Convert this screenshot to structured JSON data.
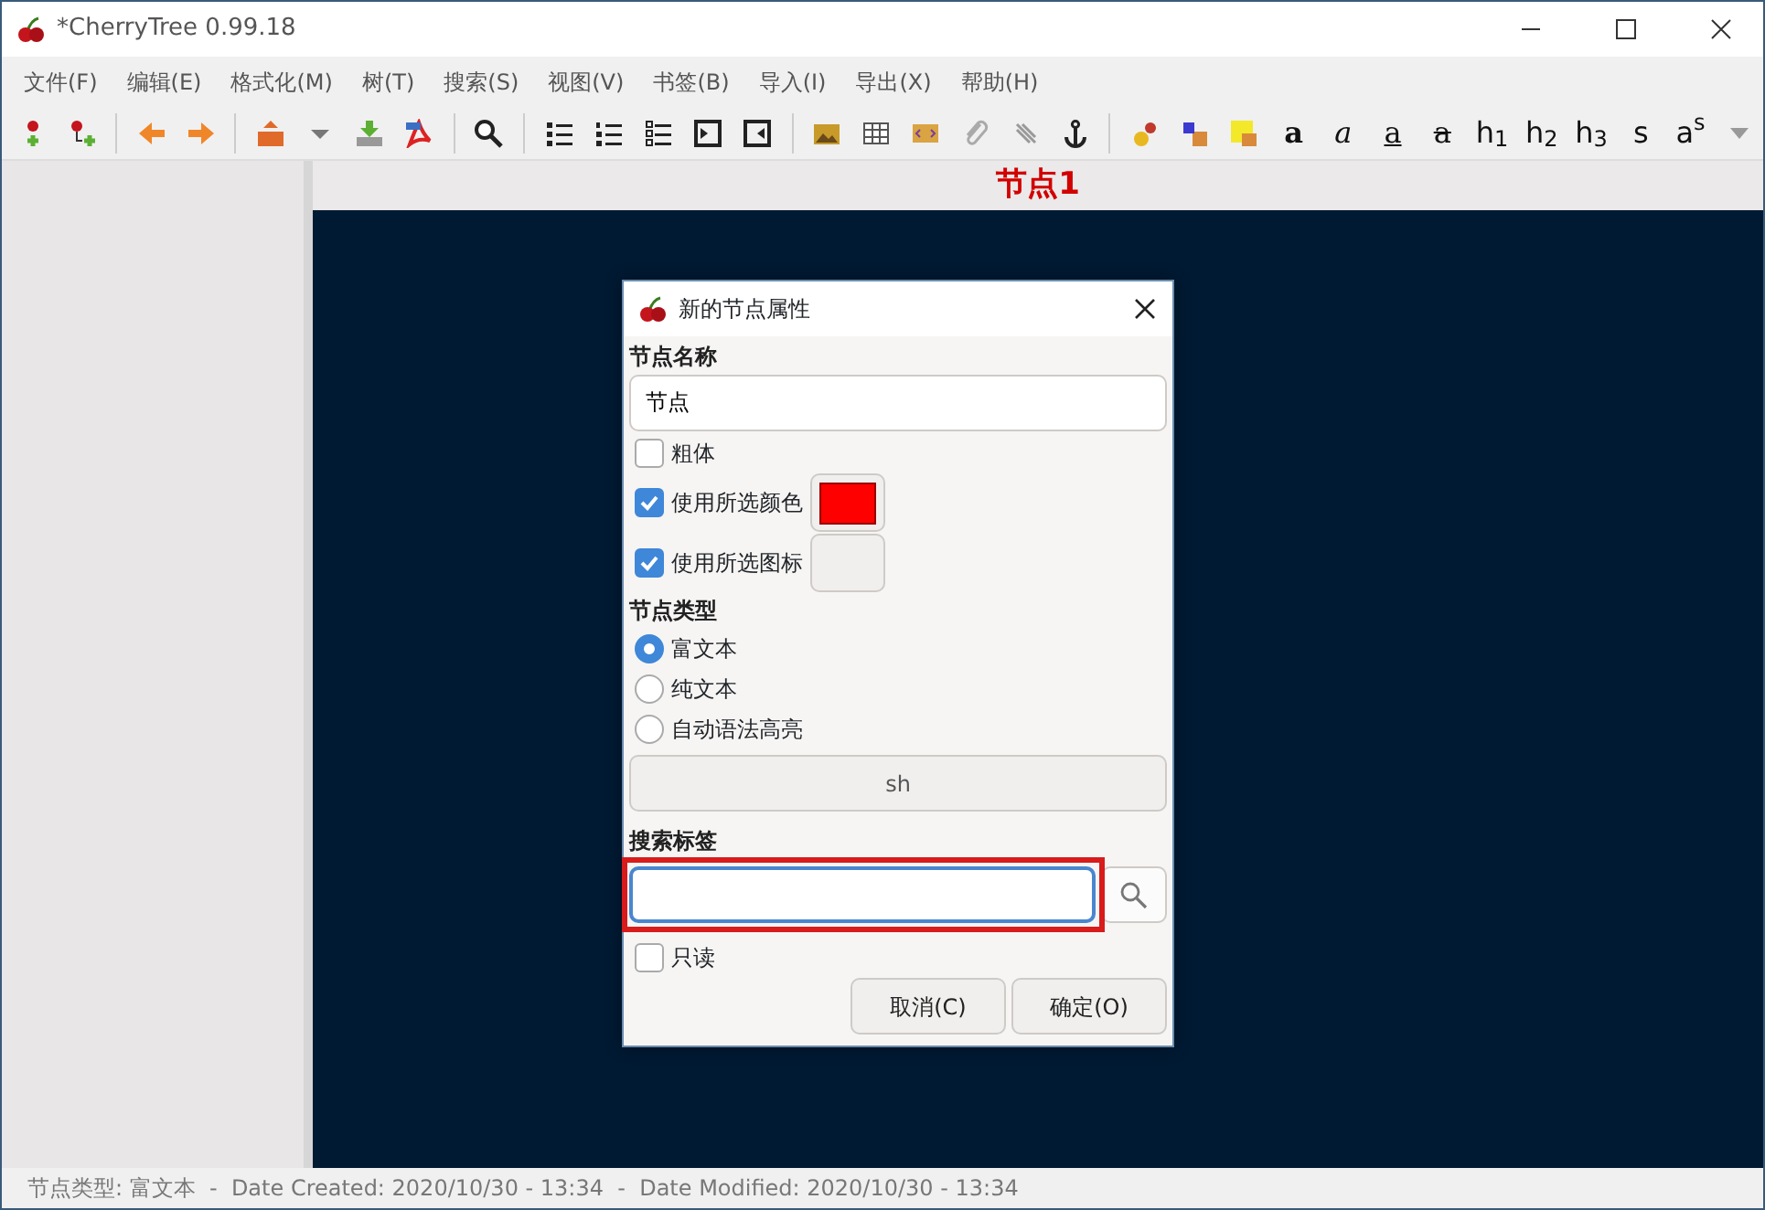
{
  "window": {
    "title": "*CherryTree 0.99.18"
  },
  "menu": [
    "文件(F)",
    "编辑(E)",
    "格式化(M)",
    "树(T)",
    "搜索(S)",
    "视图(V)",
    "书签(B)",
    "导入(I)",
    "导出(X)",
    "帮助(H)"
  ],
  "format_buttons": [
    {
      "kind": "bold",
      "label": "a"
    },
    {
      "kind": "italic",
      "label": "a"
    },
    {
      "kind": "underline",
      "label": "a"
    },
    {
      "kind": "strike",
      "label": "a"
    },
    {
      "kind": "rich",
      "label": "h$_{1}$"
    },
    {
      "kind": "rich",
      "label": "h$_{2}$"
    },
    {
      "kind": "rich",
      "label": "h$_{3}$"
    },
    {
      "kind": "plain",
      "label": "s"
    },
    {
      "kind": "rich",
      "label": "a$^{s}$"
    }
  ],
  "node_title": "节点1",
  "dialog": {
    "title": "新的节点属性",
    "name_label": "节点名称",
    "name_value": "节点",
    "options": [
      {
        "label": "粗体",
        "checked": false,
        "kind": "plain"
      },
      {
        "label": "使用所选颜色",
        "checked": true,
        "kind": "color",
        "color": "#ff0000"
      },
      {
        "label": "使用所选图标",
        "checked": true,
        "kind": "icon"
      }
    ],
    "type_label": "节点类型",
    "types": [
      {
        "label": "富文本",
        "selected": true
      },
      {
        "label": "纯文本",
        "selected": false
      },
      {
        "label": "自动语法高亮",
        "selected": false
      }
    ],
    "syntax_button": "sh",
    "tags_label": "搜索标签",
    "readonly": {
      "label": "只读",
      "checked": false
    },
    "buttons": [
      "取消(C)",
      "确定(O)"
    ]
  },
  "status_bar": "节点类型: 富文本  -  Date Created: 2020/10/30 - 13:34  -  Date Modified: 2020/10/30 - 13:34"
}
